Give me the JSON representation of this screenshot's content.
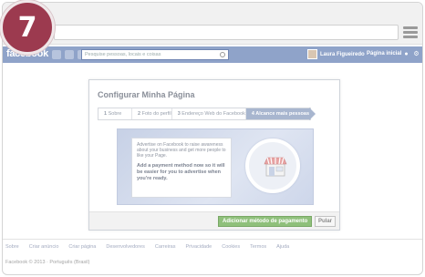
{
  "badge": {
    "number": "7"
  },
  "fbbar": {
    "logo": "facebook",
    "search_placeholder": "Pesquise pessoas, locais e coisas",
    "user_name": "Laura Figueiredo",
    "home_label": "Página inicial"
  },
  "dialog": {
    "title": "Configurar Minha Página",
    "steps": [
      {
        "num": "1",
        "label": "Sobre"
      },
      {
        "num": "2",
        "label": "Foto do perfil"
      },
      {
        "num": "3",
        "label": "Endereço Web do Facebook"
      },
      {
        "num": "4",
        "label": "Alcance mais pessoas"
      }
    ],
    "promo_text": "Advertise on Facebook to raise awareness about your business and get more people to like your Page.",
    "promo_bold": "Add a payment method now so it will be easier for you to advertise when you're ready.",
    "add_payment_button": "Adicionar método de pagamento",
    "skip_button": "Pular"
  },
  "footer": {
    "links": [
      "Sobre",
      "Criar anúncio",
      "Criar página",
      "Desenvolvedores",
      "Carreiras",
      "Privacidade",
      "Cookies",
      "Termos",
      "Ajuda"
    ],
    "copyright": "Facebook © 2013 · Português (Brasil)"
  },
  "colors": {
    "badge": "#9c3a4f",
    "fb_blue": "#8fa3c9",
    "green_button": "#8fc07b"
  }
}
